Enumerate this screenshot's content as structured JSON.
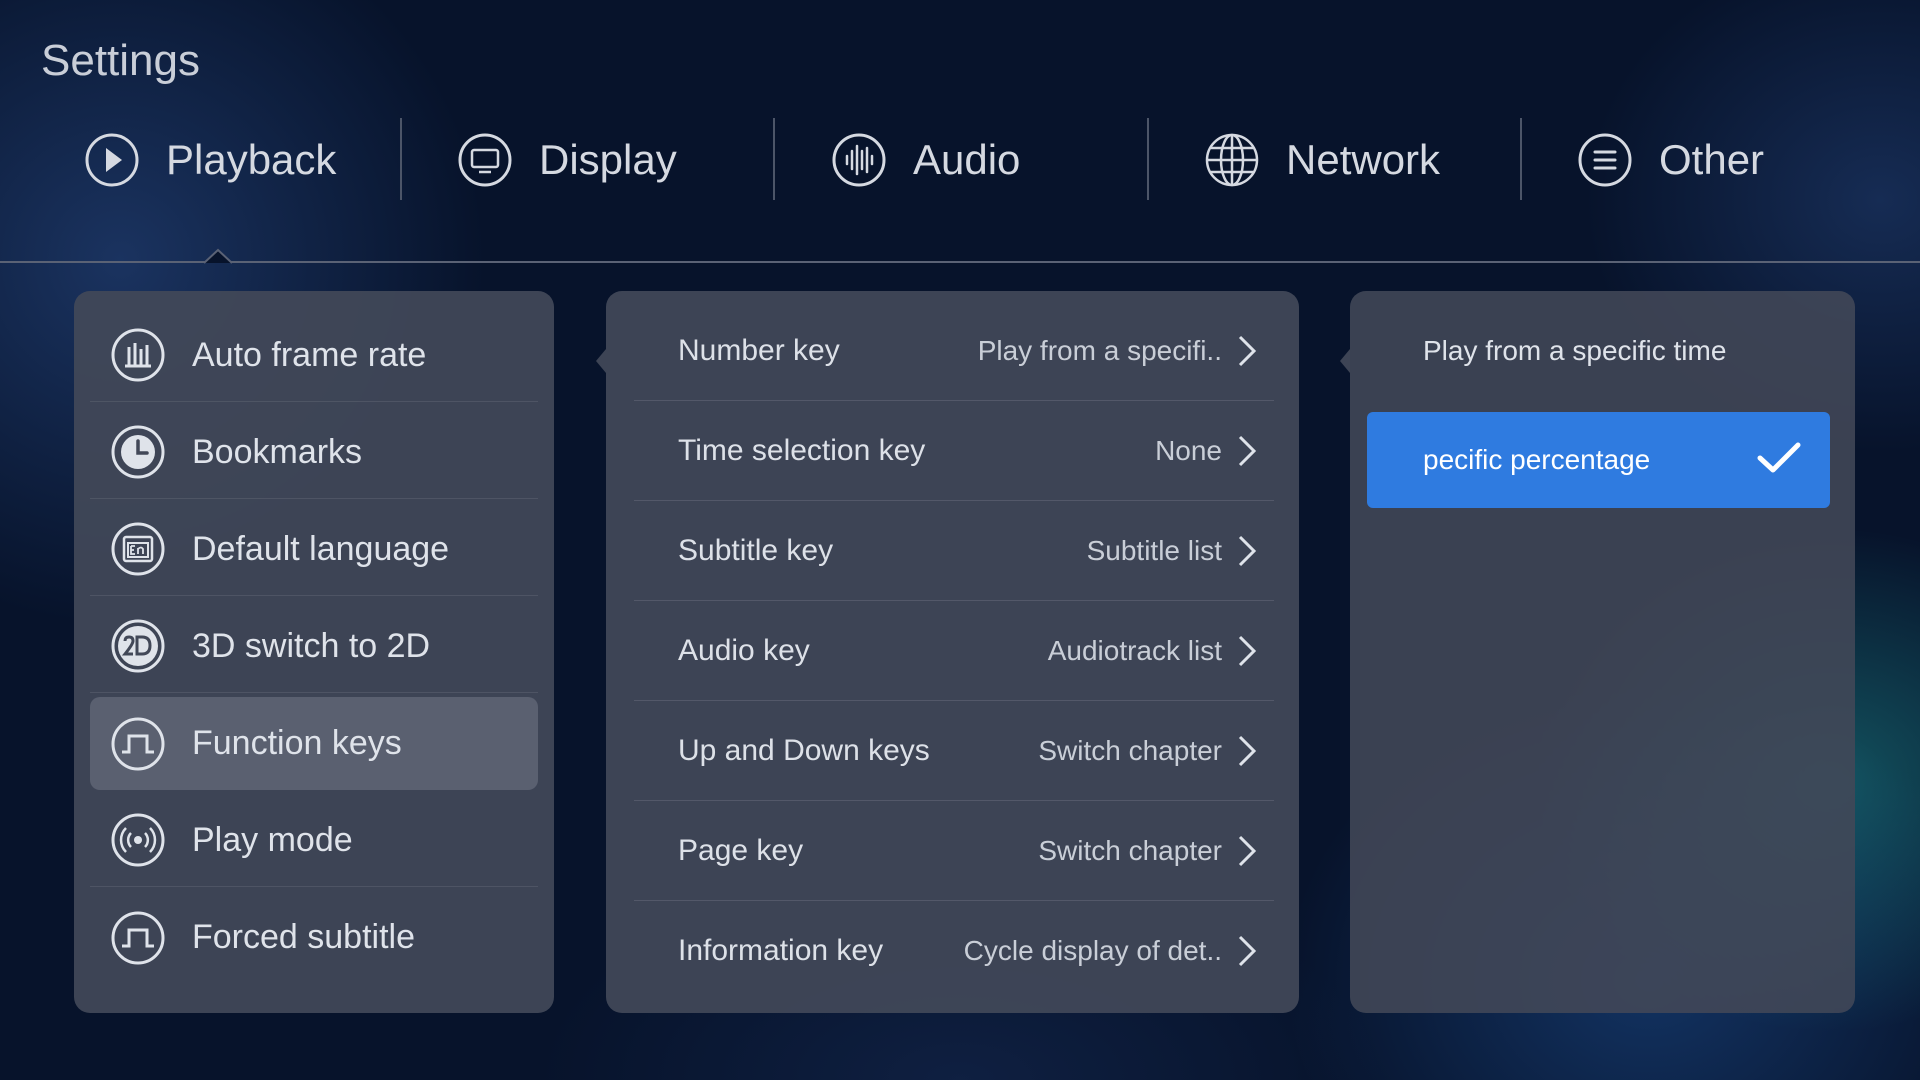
{
  "header": {
    "title": "Settings"
  },
  "tabs": [
    {
      "label": "Playback",
      "icon": "play-circle-icon"
    },
    {
      "label": "Display",
      "icon": "monitor-icon"
    },
    {
      "label": "Audio",
      "icon": "audio-wave-icon"
    },
    {
      "label": "Network",
      "icon": "globe-icon"
    },
    {
      "label": "Other",
      "icon": "menu-lines-icon"
    }
  ],
  "active_tab": "Playback",
  "menu": {
    "items": [
      {
        "label": "Auto frame rate",
        "icon": "bar-chart-icon"
      },
      {
        "label": "Bookmarks",
        "icon": "clock-icon"
      },
      {
        "label": "Default language",
        "icon": "language-en-icon"
      },
      {
        "label": "3D switch to 2D",
        "icon": "2d-icon"
      },
      {
        "label": "Function keys",
        "icon": "pulse-key-icon"
      },
      {
        "label": "Play mode",
        "icon": "broadcast-icon"
      },
      {
        "label": "Forced subtitle",
        "icon": "pulse-key-icon"
      }
    ],
    "active": "Function keys"
  },
  "function_keys": [
    {
      "label": "Number key",
      "value": "Play from a specifi.."
    },
    {
      "label": "Time selection key",
      "value": "None"
    },
    {
      "label": "Subtitle key",
      "value": "Subtitle list"
    },
    {
      "label": "Audio key",
      "value": "Audiotrack list"
    },
    {
      "label": "Up and Down keys",
      "value": "Switch chapter"
    },
    {
      "label": "Page key",
      "value": "Switch chapter"
    },
    {
      "label": "Information key",
      "value": "Cycle display of det.."
    }
  ],
  "options": {
    "items": [
      {
        "label": "Play from a specific time"
      },
      {
        "label": "pecific percentage"
      }
    ],
    "selected": "pecific percentage"
  },
  "colors": {
    "background": "#07132b",
    "panel": "#424858",
    "accent": "#2f7be0",
    "active_item": "#5a6070"
  }
}
